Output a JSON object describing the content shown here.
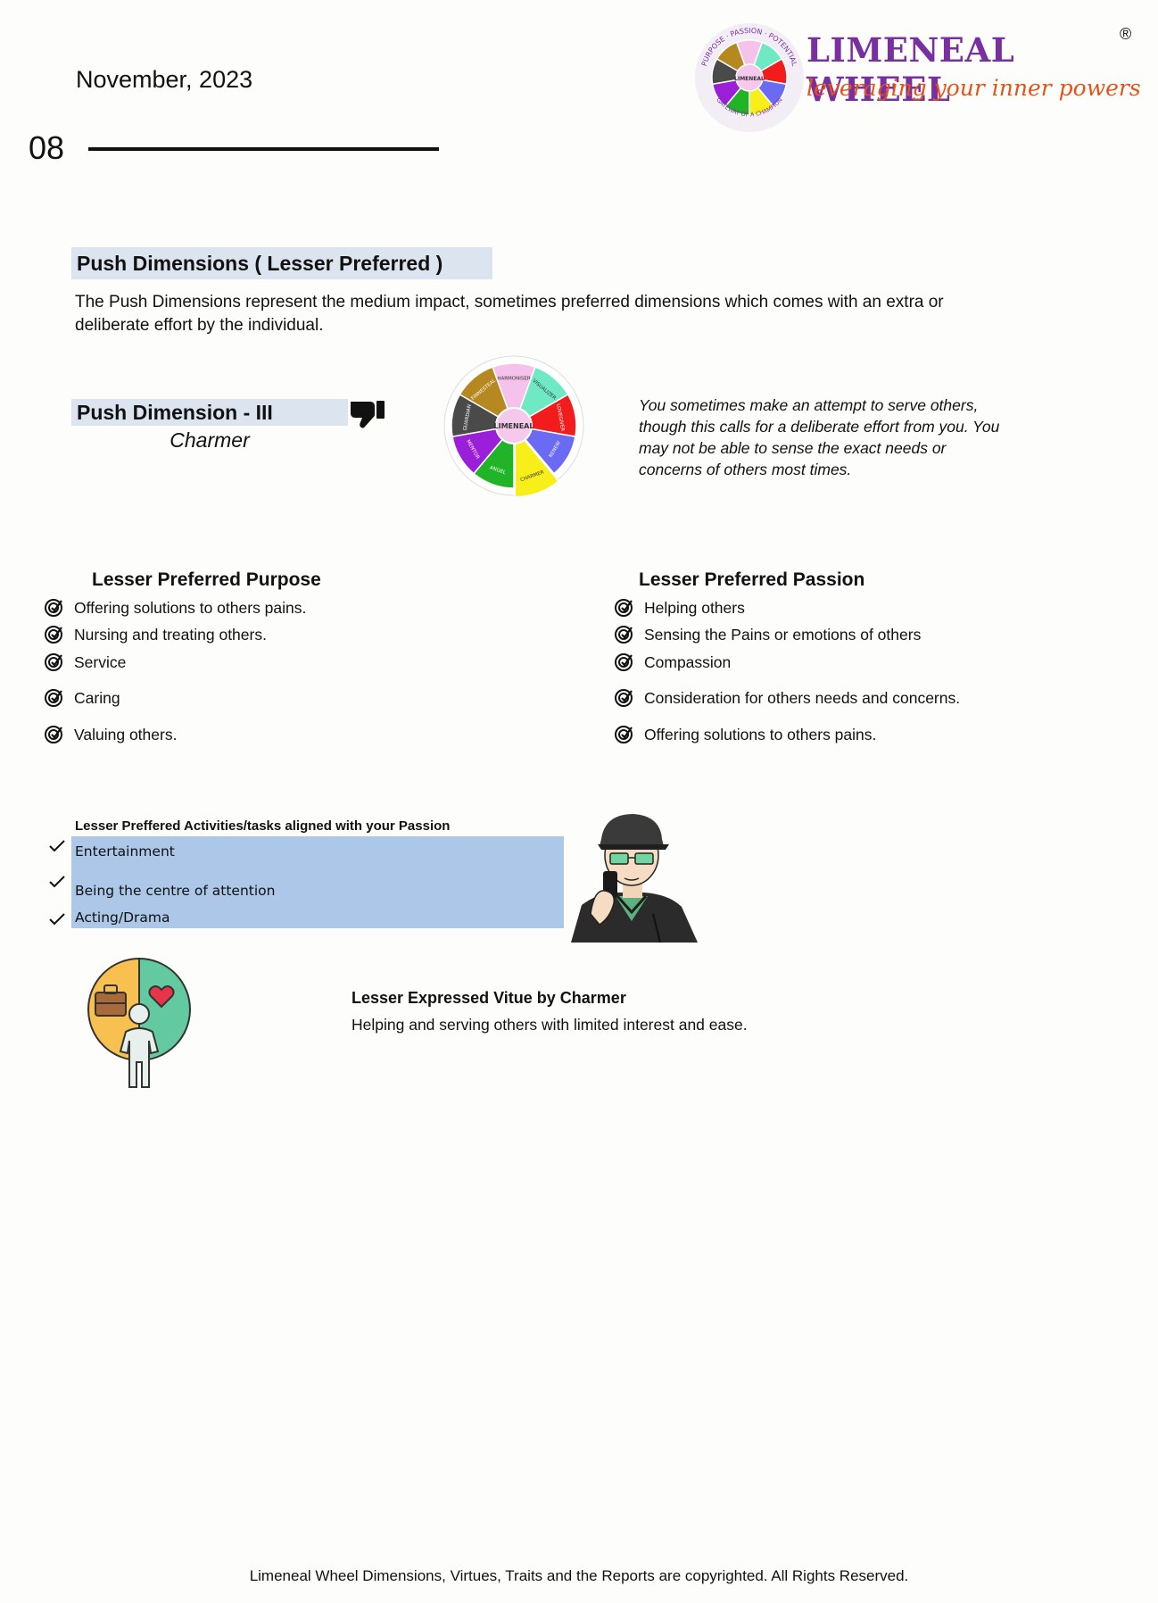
{
  "header": {
    "date": "November, 2023",
    "page_number": "08",
    "brand": "LIMENEAL WHEEL",
    "registered": "®",
    "tagline": "leveraging your inner powers"
  },
  "logo_wheel": {
    "center": "LIMENEAL",
    "ring": "PURPOSE · PASSION · POTENTIAL",
    "ring_bottom": "GATEWAY OF A CHAMPION"
  },
  "push": {
    "title": "Push Dimensions ( Lesser Preferred )",
    "intro": "The Push Dimensions represent the medium impact, sometimes preferred dimensions which comes with an extra or deliberate effort by the individual."
  },
  "dimension": {
    "title": "Push Dimension - III",
    "name": "Charmer",
    "description": "You sometimes make an attempt to serve others, though this calls for a deliberate effort from you. You may not be able to sense the exact needs or concerns of others most times."
  },
  "wheel": {
    "center": "LIMENEAL",
    "segments": [
      {
        "label": "HARMONISER",
        "color": "#f4c2ea"
      },
      {
        "label": "VISUALIZER",
        "color": "#6fe8c4"
      },
      {
        "label": "LOVEGIVER",
        "color": "#f21c1c"
      },
      {
        "label": "RENEW",
        "color": "#6a6af3"
      },
      {
        "label": "CHARMER",
        "color": "#f7ee1a"
      },
      {
        "label": "ANGEL",
        "color": "#22b428"
      },
      {
        "label": "MENTOR",
        "color": "#9b1fd8"
      },
      {
        "label": "GUARDIAN",
        "color": "#4a4a4a"
      },
      {
        "label": "FINNESTEAL",
        "color": "#b58920"
      }
    ]
  },
  "purpose": {
    "heading": "Lesser Preferred Purpose",
    "items": [
      "Offering solutions to others pains.",
      "Nursing and treating others.",
      "Service",
      "Caring",
      "Valuing others."
    ]
  },
  "passion": {
    "heading": "Lesser Preferred Passion",
    "items": [
      "Helping others",
      "Sensing the Pains or emotions of others",
      "Compassion",
      "Consideration for others needs and concerns.",
      "Offering solutions to others pains."
    ]
  },
  "activities": {
    "title": "Lesser Preffered Activities/tasks aligned with your Passion",
    "items": [
      "Entertainment",
      "Being the centre of attention",
      "Acting/Drama"
    ]
  },
  "virtue": {
    "heading": "Lesser Expressed Vitue by Charmer",
    "text": "Helping and serving others with limited interest and ease."
  },
  "footer": "Limeneal Wheel Dimensions, Virtues, Traits and the Reports are copyrighted. All Rights Reserved."
}
